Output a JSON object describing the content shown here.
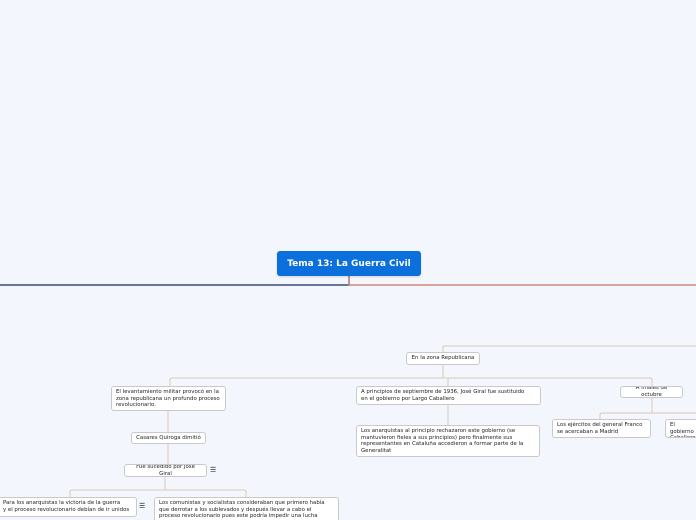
{
  "central": {
    "title": "Tema 13: La Guerra Civil"
  },
  "nodes": {
    "zona_republicana": "En la zona Republicana",
    "levantamiento": "El levantamiento militar provocó en la\nzona republicana un profundo proceso\nrevolucionario.",
    "casares": "Casares Quiroga dimitió",
    "sucedido": "Fue sucedido por José Giral",
    "anarquistas_victoria": "Para los anarquistas la victoria de la guerra\ny el proceso revolucionario debían de ir unidos",
    "comunistas": "Los comunistas y socialistas consideraban que primero había\nque derrotar a los sublevados y después llevar a cabo el\nproceso revolucionario pues este podría impedir una lucha",
    "septiembre": "A principios de septiembre de 1936, José Giral fue sustituido\nen el gobierno por Largo Caballero",
    "anarquistas_gobierno": "Los anarquistas al principio rechazaron este gobierno (se\nmantuvieron fieles a sus principios) pero finalmente sus\nrepresentantes en Cataluña accedieron a formar parte de la\nGeneralitat",
    "octubre": "A finales de octubre",
    "franco": "Los ejércitos del general Franco\nse acercaban a Madrid",
    "gobierno_caballero": "El gobierno\nCaballero"
  },
  "icons": {
    "notes": "notes-icon"
  },
  "colors": {
    "central_bg": "#0b6fdc",
    "left_branch": "#3b4a7a",
    "right_branch": "#c98a78",
    "connector": "#d8c8b8"
  }
}
